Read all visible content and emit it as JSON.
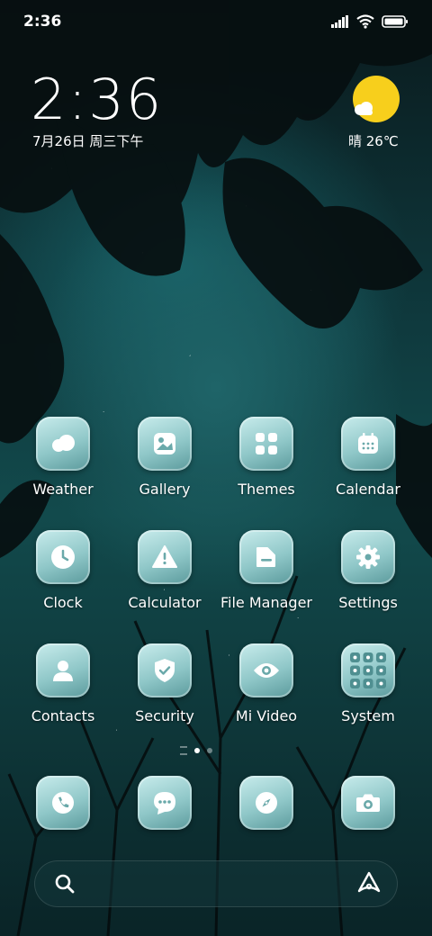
{
  "status_bar": {
    "time": "2:36"
  },
  "clock_widget": {
    "time": "2:36",
    "date": "7月26日 周三下午"
  },
  "weather_widget": {
    "condition_temp": "晴 26℃"
  },
  "apps": [
    {
      "label": "Weather",
      "icon": "weather-cloud-icon"
    },
    {
      "label": "Gallery",
      "icon": "image-icon"
    },
    {
      "label": "Themes",
      "icon": "grid-icon"
    },
    {
      "label": "Calendar",
      "icon": "calendar-icon"
    },
    {
      "label": "Clock",
      "icon": "clock-icon"
    },
    {
      "label": "Calculator",
      "icon": "warning-icon"
    },
    {
      "label": "File Manager",
      "icon": "folder-icon"
    },
    {
      "label": "Settings",
      "icon": "gear-icon"
    },
    {
      "label": "Contacts",
      "icon": "person-icon"
    },
    {
      "label": "Security",
      "icon": "shield-icon"
    },
    {
      "label": "Mi Video",
      "icon": "eye-icon"
    },
    {
      "label": "System",
      "icon": "folder-grid-icon"
    }
  ],
  "dock": [
    {
      "icon": "phone-icon"
    },
    {
      "icon": "message-icon"
    },
    {
      "icon": "compass-icon"
    },
    {
      "icon": "camera-icon"
    }
  ],
  "page_indicator": {
    "pages": 2,
    "active": 1
  },
  "colors": {
    "tile_top": "#c8ecec",
    "tile_bottom": "#5b9a9c",
    "sun": "#f7cf1c"
  }
}
